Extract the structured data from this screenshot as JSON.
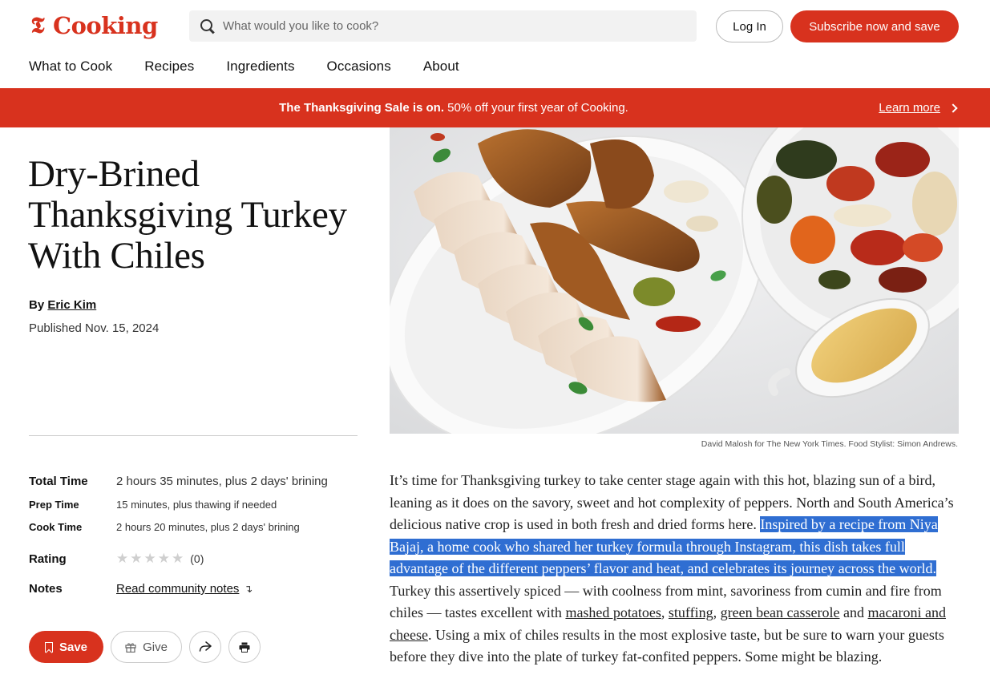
{
  "header": {
    "logo_t": "𝕿",
    "logo_word": "Cooking",
    "search_placeholder": "What would you like to cook?",
    "login_label": "Log In",
    "subscribe_label": "Subscribe now and save"
  },
  "nav": {
    "items": [
      "What to Cook",
      "Recipes",
      "Ingredients",
      "Occasions",
      "About"
    ]
  },
  "banner": {
    "bold": "The Thanksgiving Sale is on.",
    "rest": " 50% off your first year of Cooking.",
    "link": "Learn more"
  },
  "recipe": {
    "title": "Dry-Brined Thanksgiving Turkey With Chiles",
    "by_prefix": "By ",
    "author": "Eric Kim",
    "published": "Published Nov. 15, 2024",
    "total_time_label": "Total Time",
    "total_time": "2 hours 35 minutes, plus 2 days' brining",
    "prep_time_label": "Prep Time",
    "prep_time": "15 minutes, plus thawing if needed",
    "cook_time_label": "Cook Time",
    "cook_time": "2 hours 20 minutes, plus 2 days' brining",
    "rating_label": "Rating",
    "rating_stars": 0,
    "rating_count": "(0)",
    "notes_label": "Notes",
    "notes_link": "Read community notes",
    "save_label": "Save",
    "give_label": "Give",
    "photo_credit": "David Malosh for The New York Times. Food Stylist: Simon Andrews."
  },
  "body": {
    "p1": "It’s time for Thanksgiving turkey to take center stage again with this hot, blazing sun of a bird, leaning as it does on the savory, sweet and hot complexity of peppers. North and South America’s delicious native crop is used in both fresh and dried forms here. ",
    "highlighted": "Inspired by a recipe from Niya Bajaj, a home cook who shared her turkey formula through Instagram, this dish takes full advantage of the different peppers’ flavor and heat, and celebrates its journey across the world.",
    "p2": " Turkey this assertively spiced — with coolness from mint, savoriness from cumin and fire from chiles — tastes excellent with ",
    "link1": "mashed potatoes",
    "sep1": ", ",
    "link2": "stuffing",
    "sep2": ", ",
    "link3": "green bean casserole",
    "sep3": " and ",
    "link4": "macaroni and cheese",
    "p3": ". Using a mix of chiles results in the most explosive taste, but be sure to warn your guests before they dive into the plate of turkey fat-confited peppers. Some might be blazing."
  },
  "colors": {
    "brand": "#d8321e",
    "highlight": "#2f6ed2"
  }
}
